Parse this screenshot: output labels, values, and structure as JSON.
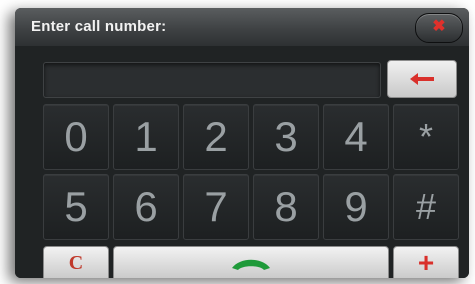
{
  "dialog": {
    "title": "Enter call number:",
    "close_icon": "close-icon"
  },
  "display": {
    "value": ""
  },
  "keys": {
    "row1": [
      "0",
      "1",
      "2",
      "3",
      "4",
      "*"
    ],
    "row2": [
      "5",
      "6",
      "7",
      "8",
      "9",
      "#"
    ]
  },
  "buttons": {
    "backspace_icon": "arrow-left-icon",
    "clear_label": "C",
    "call_icon": "phone-handset-icon",
    "add_label": "+"
  },
  "colors": {
    "accent_red": "#d9302b",
    "call_green": "#1f9a3a"
  }
}
